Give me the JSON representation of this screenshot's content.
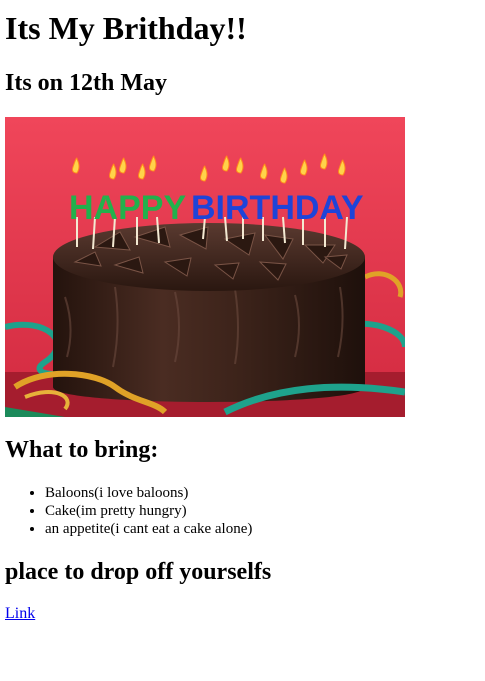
{
  "page": {
    "title": "Its My Brithday!!",
    "subtitle": "Its on 12th May"
  },
  "photo": {
    "name": "birthday-cake-photo",
    "candle_text": [
      "HAPPY",
      "BIRTHDAY"
    ],
    "colors": {
      "background": "#e8344a",
      "cake": "#3a221a",
      "ribbon_gold": "#e0a227",
      "ribbon_teal": "#1ea28c"
    }
  },
  "bring": {
    "heading": "What to bring:",
    "items": [
      "Baloons(i love baloons)",
      "Cake(im pretty hungry)",
      "an appetite(i cant eat a cake alone)"
    ]
  },
  "dropoff": {
    "heading": "place to drop off yourselfs",
    "link_text": "Link"
  },
  "colors": {
    "link": "#0000ee",
    "text": "#000000",
    "background": "#ffffff"
  }
}
